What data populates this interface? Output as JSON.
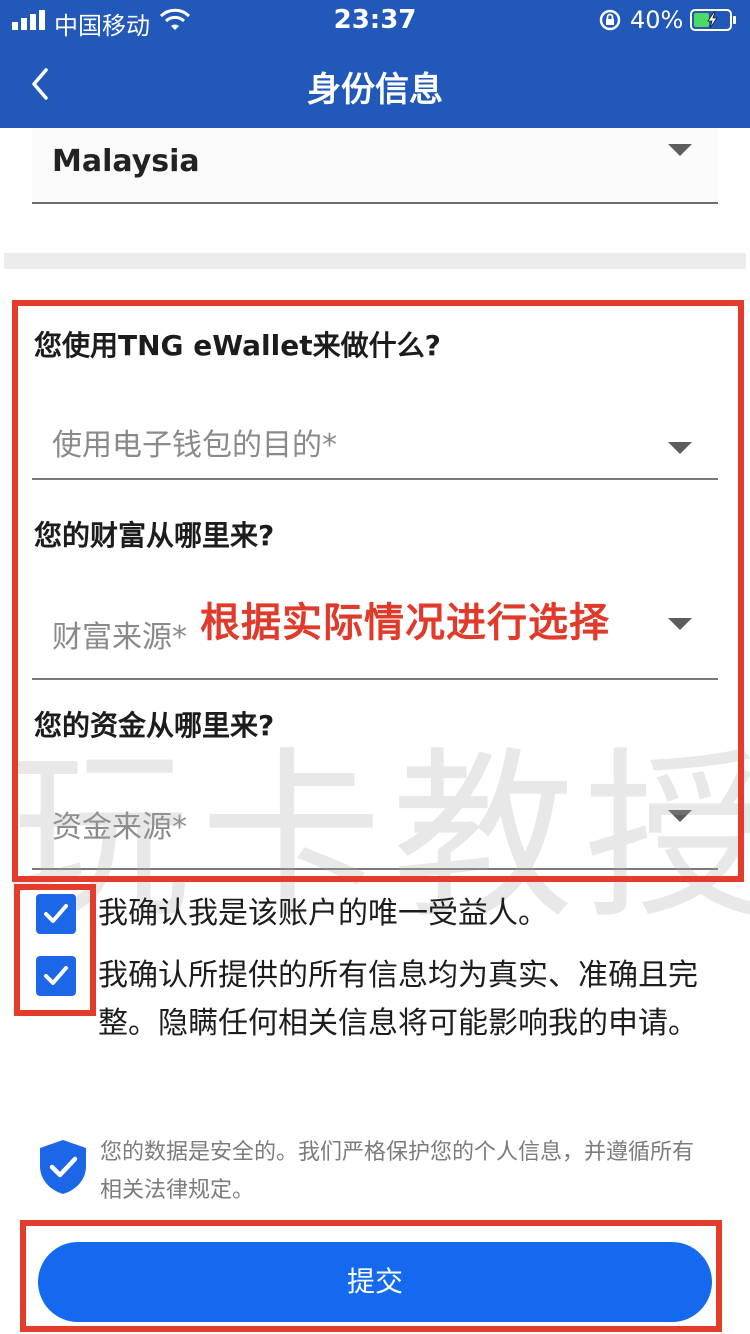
{
  "status_bar": {
    "carrier": "中国移动",
    "time": "23:37",
    "battery": "40%"
  },
  "nav": {
    "title": "身份信息"
  },
  "country": {
    "value": "Malaysia"
  },
  "questions": [
    {
      "label": "您使用TNG eWallet来做什么?",
      "placeholder": "使用电子钱包的目的*"
    },
    {
      "label": "您的财富从哪里来?",
      "placeholder": "财富来源*"
    },
    {
      "label": "您的资金从哪里来?",
      "placeholder": "资金来源*"
    }
  ],
  "annotation": "根据实际情况进行选择",
  "watermark": "玩卡教授",
  "consents": [
    {
      "text": "我确认我是该账户的唯一受益人。",
      "checked": true
    },
    {
      "text": "我确认所提供的所有信息均为真实、准确且完整。隐瞒任何相关信息将可能影响我的申请。",
      "checked": true
    }
  ],
  "security_note": "您的数据是安全的。我们严格保护您的个人信息，并遵循所有相关法律规定。",
  "submit": {
    "label": "提交"
  },
  "colors": {
    "header_blue": "#2158b9",
    "button_blue": "#1469ef",
    "checkbox_blue": "#1c67e8",
    "highlight_red": "#e53b2b"
  }
}
